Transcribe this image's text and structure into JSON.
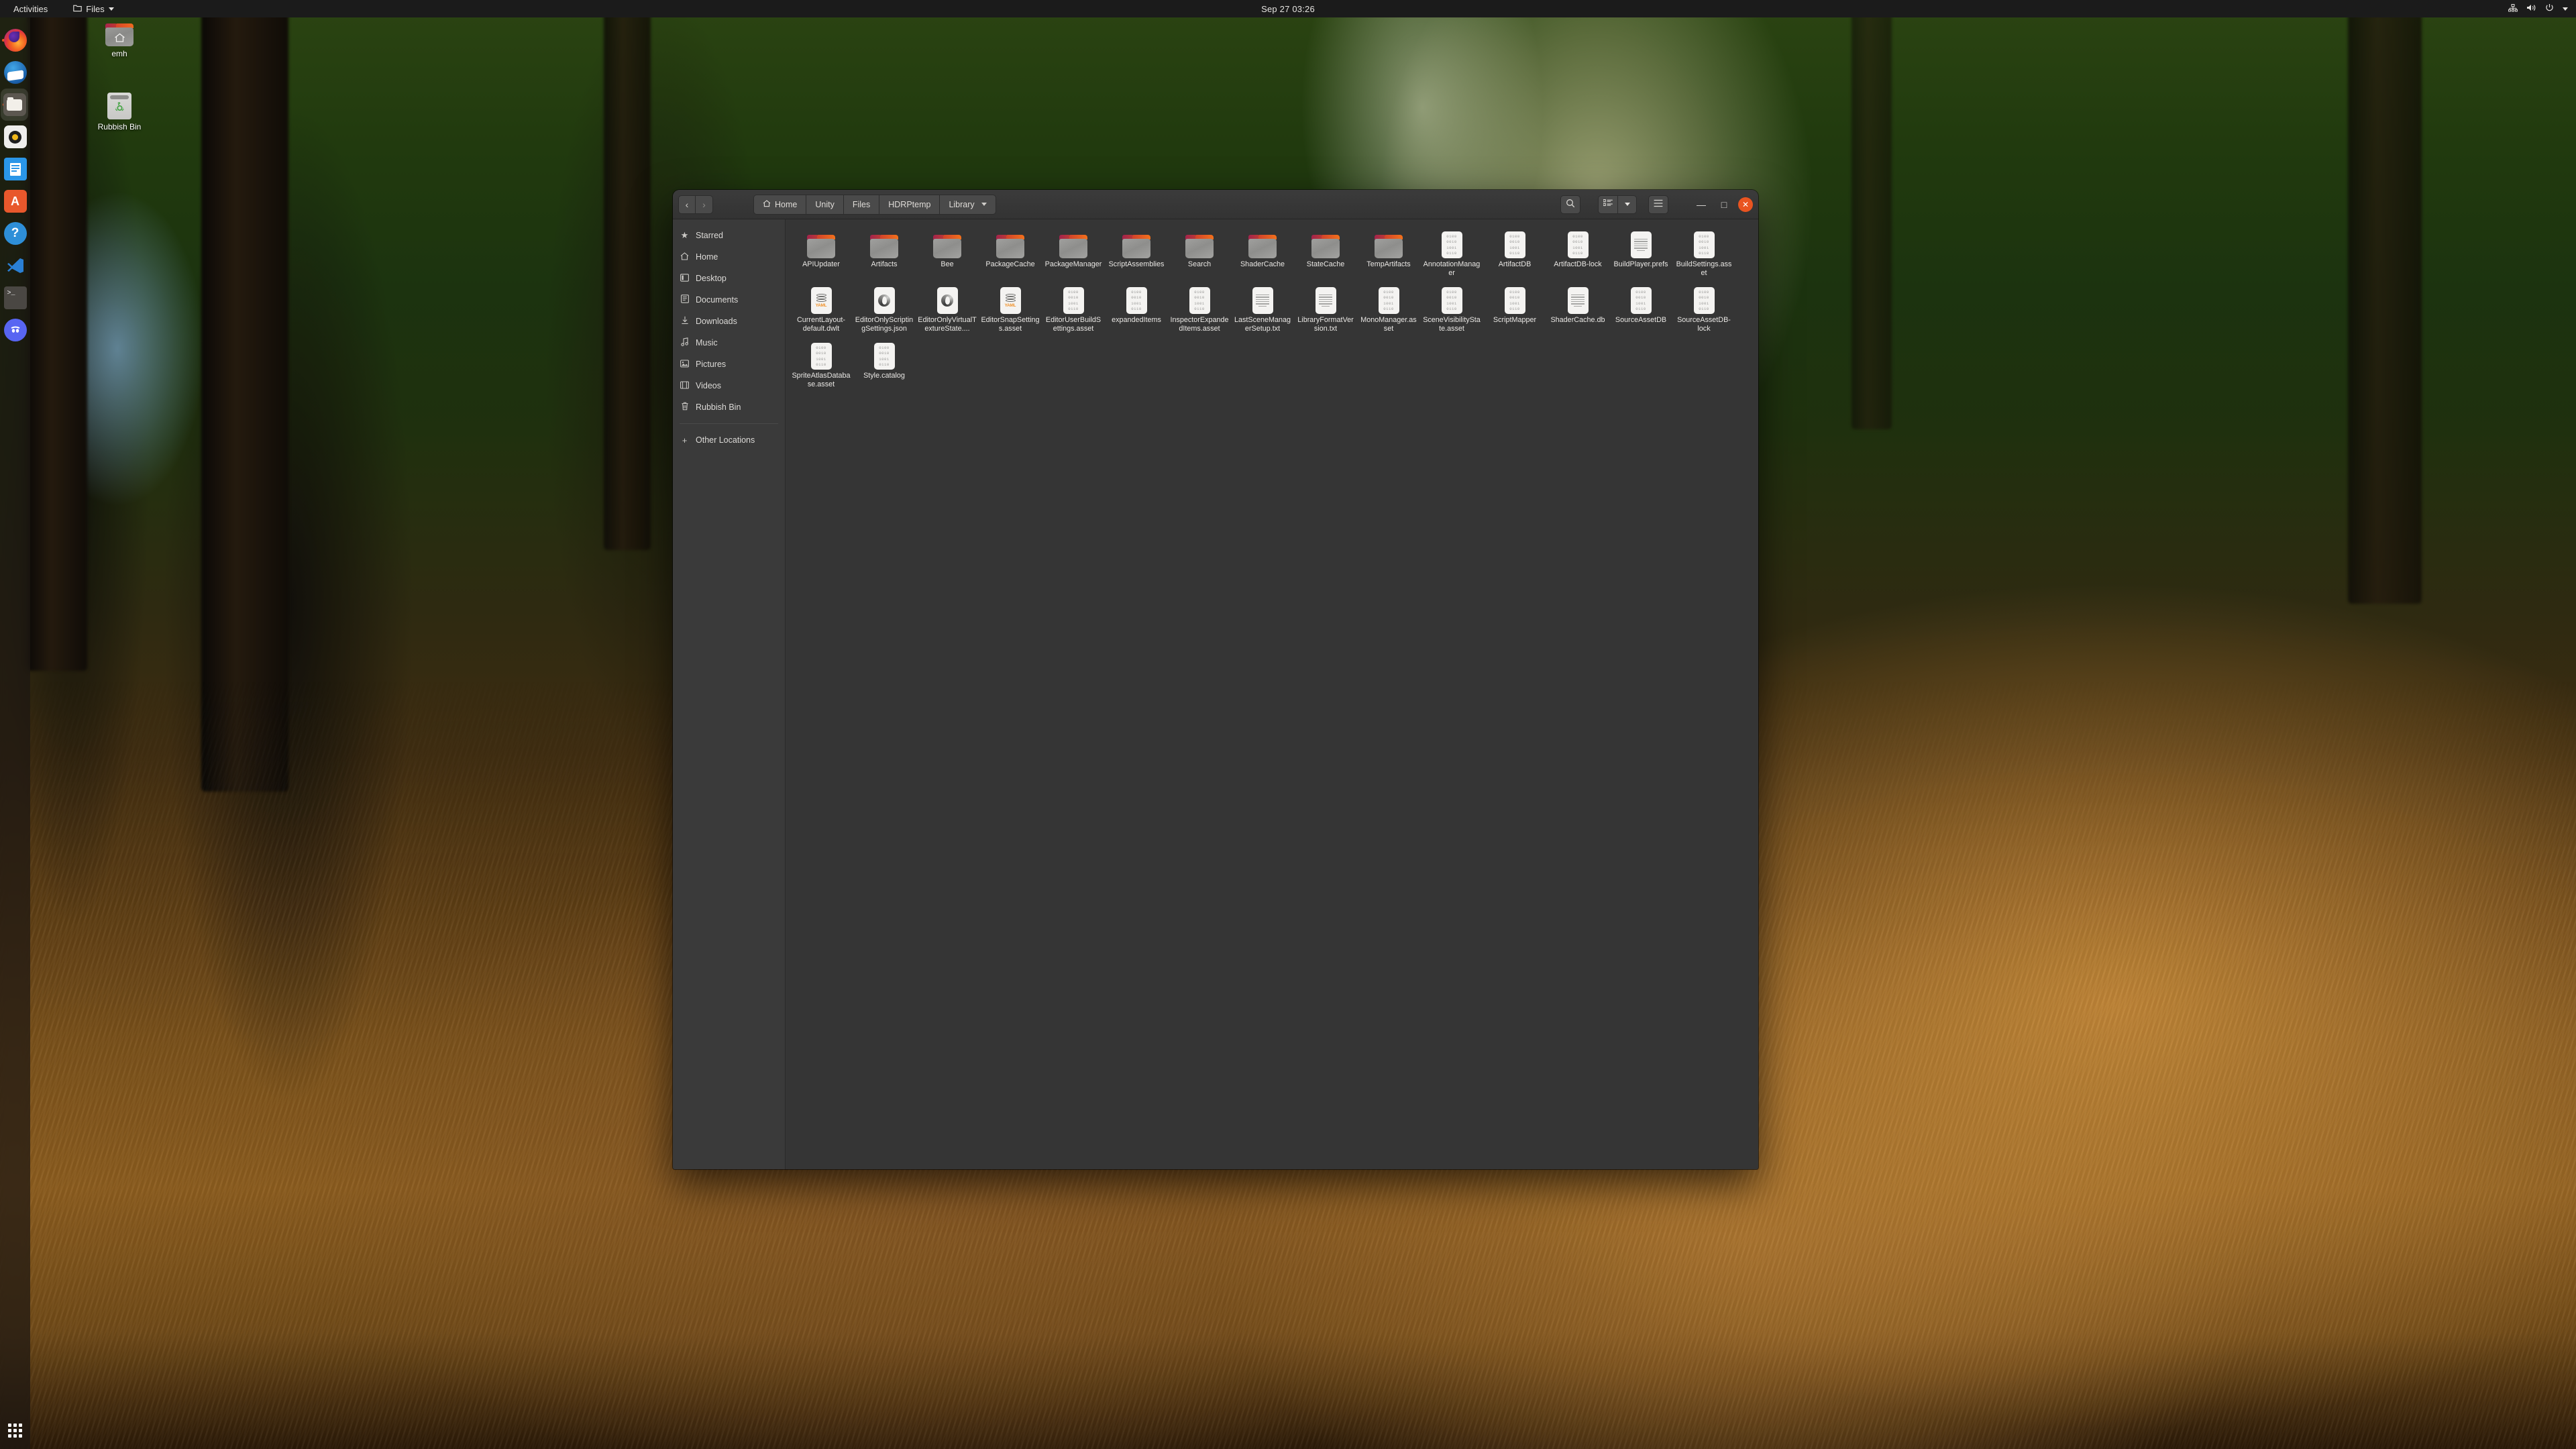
{
  "topbar": {
    "activities": "Activities",
    "app_menu": "Files",
    "clock": "Sep 27  03:26",
    "indicators": [
      "network-icon",
      "volume-icon",
      "power-icon",
      "chevron-down-icon"
    ]
  },
  "dock": {
    "items": [
      {
        "name": "firefox",
        "label": "Firefox",
        "running": true,
        "active": false
      },
      {
        "name": "thunderbird",
        "label": "Thunderbird",
        "running": false,
        "active": false
      },
      {
        "name": "files",
        "label": "Files",
        "running": true,
        "active": true
      },
      {
        "name": "rhythmbox",
        "label": "Rhythmbox",
        "running": false,
        "active": false
      },
      {
        "name": "libreoffice-writer",
        "label": "LibreOffice Writer",
        "running": false,
        "active": false
      },
      {
        "name": "ubuntu-software",
        "label": "Ubuntu Software",
        "running": false,
        "active": false
      },
      {
        "name": "help",
        "label": "Help",
        "running": false,
        "active": false
      },
      {
        "name": "vscode",
        "label": "Visual Studio Code",
        "running": false,
        "active": false
      },
      {
        "name": "terminal",
        "label": "Terminal",
        "running": false,
        "active": false
      },
      {
        "name": "discord",
        "label": "Discord",
        "running": false,
        "active": false
      }
    ],
    "show_apps_label": "Show Applications"
  },
  "desktop": {
    "icons": [
      {
        "label": "emh",
        "type": "home-folder"
      },
      {
        "label": "Rubbish Bin",
        "type": "trash"
      }
    ]
  },
  "window": {
    "title": "Library",
    "nav": {
      "back": "‹",
      "forward": "›"
    },
    "breadcrumbs": [
      {
        "label": "Home",
        "icon": "home-icon",
        "active": false
      },
      {
        "label": "Unity",
        "icon": null,
        "active": false
      },
      {
        "label": "Files",
        "icon": null,
        "active": false
      },
      {
        "label": "HDRPtemp",
        "icon": null,
        "active": false
      },
      {
        "label": "Library",
        "icon": null,
        "active": true
      }
    ],
    "search_placeholder": "Search",
    "buttons": {
      "search": "search-icon",
      "view_grid": "grid-view-icon",
      "view_dropdown": "chevron-down-icon",
      "menu": "hamburger-menu-icon",
      "minimize": "—",
      "maximize": "□",
      "close": "✕"
    },
    "accent_color": "#e95420"
  },
  "sidebar": {
    "items": [
      {
        "label": "Starred",
        "icon": "star-icon"
      },
      {
        "label": "Home",
        "icon": "home-icon"
      },
      {
        "label": "Desktop",
        "icon": "desktop-icon"
      },
      {
        "label": "Documents",
        "icon": "documents-icon"
      },
      {
        "label": "Downloads",
        "icon": "download-icon"
      },
      {
        "label": "Music",
        "icon": "music-icon"
      },
      {
        "label": "Pictures",
        "icon": "pictures-icon"
      },
      {
        "label": "Videos",
        "icon": "videos-icon"
      },
      {
        "label": "Rubbish Bin",
        "icon": "trash-icon"
      }
    ],
    "other_locations": {
      "label": "Other Locations",
      "icon": "plus-icon"
    }
  },
  "files": {
    "binary_icon_text": [
      "0100",
      "0010",
      "1001",
      "0110"
    ],
    "yaml_icon_text": "YAML",
    "items": [
      {
        "name": "APIUpdater",
        "type": "folder"
      },
      {
        "name": "Artifacts",
        "type": "folder"
      },
      {
        "name": "Bee",
        "type": "folder"
      },
      {
        "name": "PackageCache",
        "type": "folder"
      },
      {
        "name": "PackageManager",
        "type": "folder"
      },
      {
        "name": "ScriptAssemblies",
        "type": "folder"
      },
      {
        "name": "Search",
        "type": "folder"
      },
      {
        "name": "ShaderCache",
        "type": "folder"
      },
      {
        "name": "StateCache",
        "type": "folder"
      },
      {
        "name": "TempArtifacts",
        "type": "folder"
      },
      {
        "name": "AnnotationManager",
        "type": "binary"
      },
      {
        "name": "ArtifactDB",
        "type": "binary"
      },
      {
        "name": "ArtifactDB-lock",
        "type": "binary"
      },
      {
        "name": "BuildPlayer.prefs",
        "type": "text"
      },
      {
        "name": "BuildSettings.asset",
        "type": "binary"
      },
      {
        "name": "CurrentLayout-default.dwlt",
        "type": "yaml"
      },
      {
        "name": "EditorOnlyScriptingSettings.json",
        "type": "json"
      },
      {
        "name": "EditorOnlyVirtualTextureState....",
        "type": "json"
      },
      {
        "name": "EditorSnapSettings.asset",
        "type": "yaml"
      },
      {
        "name": "EditorUserBuildSettings.asset",
        "type": "binary"
      },
      {
        "name": "expandedItems",
        "type": "binary"
      },
      {
        "name": "InspectorExpandedItems.asset",
        "type": "binary"
      },
      {
        "name": "LastSceneManagerSetup.txt",
        "type": "text"
      },
      {
        "name": "LibraryFormatVersion.txt",
        "type": "text"
      },
      {
        "name": "MonoManager.asset",
        "type": "binary"
      },
      {
        "name": "SceneVisibilityState.asset",
        "type": "binary"
      },
      {
        "name": "ScriptMapper",
        "type": "binary"
      },
      {
        "name": "ShaderCache.db",
        "type": "text"
      },
      {
        "name": "SourceAssetDB",
        "type": "binary"
      },
      {
        "name": "SourceAssetDB-lock",
        "type": "binary"
      },
      {
        "name": "SpriteAtlasDatabase.asset",
        "type": "binary"
      },
      {
        "name": "Style.catalog",
        "type": "binary"
      }
    ]
  }
}
